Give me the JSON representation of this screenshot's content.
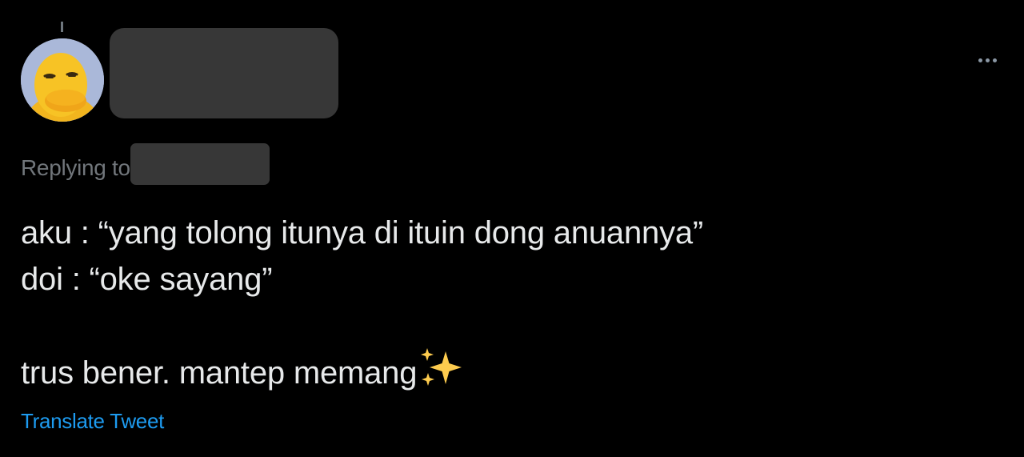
{
  "tweet": {
    "author_avatar_icon": "duck-avatar",
    "more_icon": "ellipsis-icon",
    "replying_to_label": "Replying to",
    "lines": [
      "aku : “yang tolong itunya di ituin dong anuannya”",
      "doi : “oke sayang”",
      "",
      "trus bener. mantep memang"
    ],
    "trailing_emoji": "sparkles",
    "translate_label": "Translate Tweet"
  },
  "colors": {
    "background": "#000000",
    "text": "#e7e9ea",
    "muted": "#71767b",
    "link": "#1d9bf0",
    "redaction": "#373737"
  }
}
